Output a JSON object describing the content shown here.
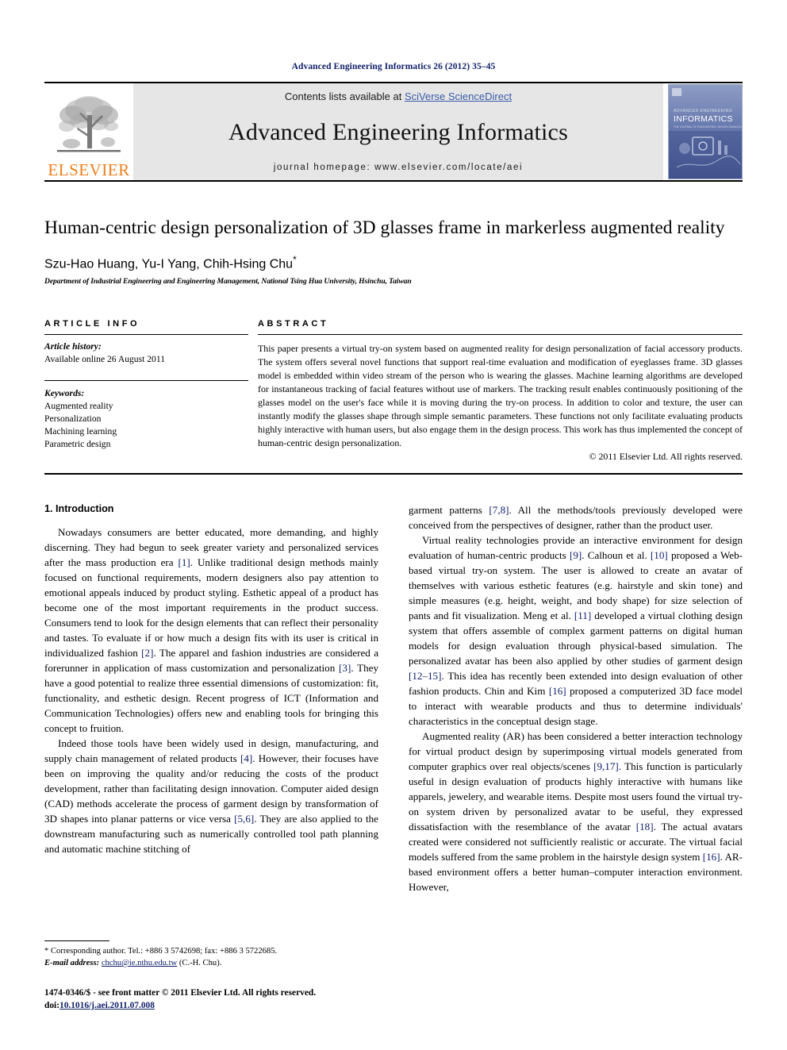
{
  "running_head": "Advanced Engineering Informatics 26 (2012) 35–45",
  "masthead": {
    "publisher_name": "ELSEVIER",
    "contents_prefix": "Contents lists available at ",
    "contents_link": "SciVerse ScienceDirect",
    "journal_title": "Advanced Engineering Informatics",
    "homepage": "journal homepage: www.elsevier.com/locate/aei",
    "cover": {
      "line1": "ADVANCED ENGINEERING",
      "line2": "INFORMATICS",
      "line3": "THE JOURNAL OF ENGINEERING, DESIGN, MANUFACTURING"
    }
  },
  "article": {
    "title": "Human-centric design personalization of 3D glasses frame in markerless augmented reality",
    "authors": "Szu-Hao Huang, Yu-I Yang, Chih-Hsing Chu",
    "corresponding_marker": "*",
    "affiliation": "Department of Industrial Engineering and Engineering Management, National Tsing Hua University, Hsinchu, Taiwan"
  },
  "article_info": {
    "heading": "ARTICLE INFO",
    "history_label": "Article history:",
    "history_value": "Available online 26 August 2011",
    "keywords_label": "Keywords:",
    "keywords": [
      "Augmented reality",
      "Personalization",
      "Machining learning",
      "Parametric design"
    ]
  },
  "abstract": {
    "heading": "ABSTRACT",
    "text": "This paper presents a virtual try-on system based on augmented reality for design personalization of facial accessory products. The system offers several novel functions that support real-time evaluation and modification of eyeglasses frame. 3D glasses model is embedded within video stream of the person who is wearing the glasses. Machine learning algorithms are developed for instantaneous tracking of facial features without use of markers. The tracking result enables continuously positioning of the glasses model on the user's face while it is moving during the try-on process. In addition to color and texture, the user can instantly modify the glasses shape through simple semantic parameters. These functions not only facilitate evaluating products highly interactive with human users, but also engage them in the design process. This work has thus implemented the concept of human-centric design personalization.",
    "copyright": "© 2011 Elsevier Ltd. All rights reserved."
  },
  "body": {
    "section_number_title": "1. Introduction",
    "left_paragraphs": [
      "Nowadays consumers are better educated, more demanding, and highly discerning. They had begun to seek greater variety and personalized services after the mass production era [1]. Unlike traditional design methods mainly focused on functional requirements, modern designers also pay attention to emotional appeals induced by product styling. Esthetic appeal of a product has become one of the most important requirements in the product success. Consumers tend to look for the design elements that can reflect their personality and tastes. To evaluate if or how much a design fits with its user is critical in individualized fashion [2]. The apparel and fashion industries are considered a forerunner in application of mass customization and personalization [3]. They have a good potential to realize three essential dimensions of customization: fit, functionality, and esthetic design. Recent progress of ICT (Information and Communication Technologies) offers new and enabling tools for bringing this concept to fruition.",
      "Indeed those tools have been widely used in design, manufacturing, and supply chain management of related products [4]. However, their focuses have been on improving the quality and/or reducing the costs of the product development, rather than facilitating design innovation. Computer aided design (CAD) methods accelerate the process of garment design by transformation of 3D shapes into planar patterns or vice versa [5,6]. They are also applied to the downstream manufacturing such as numerically controlled tool path planning and automatic machine stitching of"
    ],
    "right_paragraphs": [
      "garment patterns [7,8]. All the methods/tools previously developed were conceived from the perspectives of designer, rather than the product user.",
      "Virtual reality technologies provide an interactive environment for design evaluation of human-centric products [9]. Calhoun et al. [10] proposed a Web-based virtual try-on system. The user is allowed to create an avatar of themselves with various esthetic features (e.g. hairstyle and skin tone) and simple measures (e.g. height, weight, and body shape) for size selection of pants and fit visualization. Meng et al. [11] developed a virtual clothing design system that offers assemble of complex garment patterns on digital human models for design evaluation through physical-based simulation. The personalized avatar has been also applied by other studies of garment design [12–15]. This idea has recently been extended into design evaluation of other fashion products. Chin and Kim [16] proposed a computerized 3D face model to interact with wearable products and thus to determine individuals' characteristics in the conceptual design stage.",
      "Augmented reality (AR) has been considered a better interaction technology for virtual product design by superimposing virtual models generated from computer graphics over real objects/scenes [9,17]. This function is particularly useful in design evaluation of products highly interactive with humans like apparels, jewelery, and wearable items. Despite most users found the virtual try-on system driven by personalized avatar to be useful, they expressed dissatisfaction with the resemblance of the avatar [18]. The actual avatars created were considered not sufficiently realistic or accurate. The virtual facial models suffered from the same problem in the hairstyle design system [16]. AR-based environment offers a better human–computer interaction environment. However,"
    ]
  },
  "footnote": {
    "corresponding": "* Corresponding author. Tel.: +886 3 5742698; fax: +886 3 5722685.",
    "email_label": "E-mail address:",
    "email": "chchu@ie.nthu.edu.tw",
    "email_suffix": "(C.-H. Chu)."
  },
  "imprint": {
    "issn_line": "1474-0346/$ - see front matter © 2011 Elsevier Ltd. All rights reserved.",
    "doi_label": "doi:",
    "doi_value": "10.1016/j.aei.2011.07.008"
  },
  "colors": {
    "link_blue": "#3a5ba8",
    "ref_blue": "#12216b",
    "elsevier_orange": "#f07f1a",
    "masthead_grey": "#e6e6e6"
  }
}
